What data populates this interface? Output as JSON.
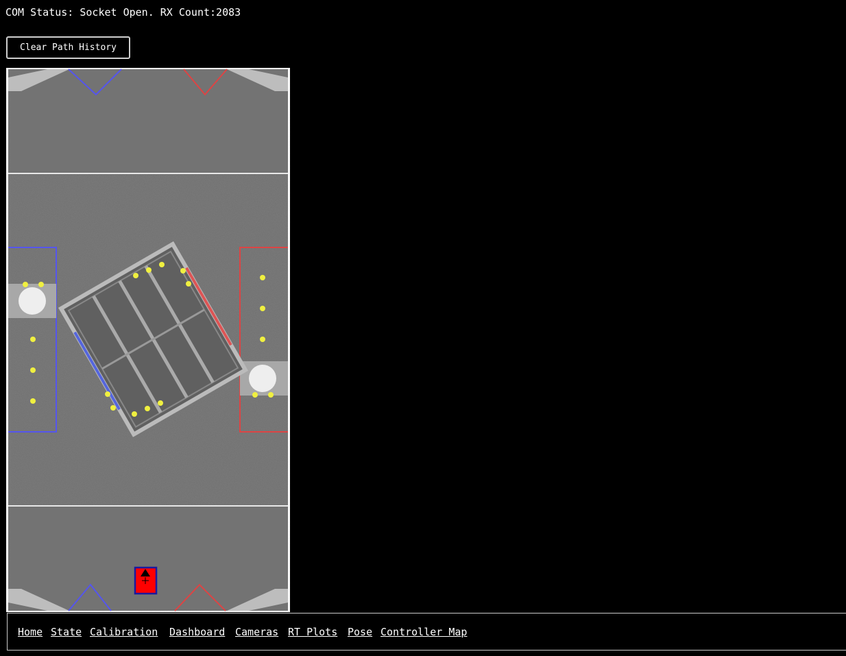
{
  "status": {
    "text": "COM Status: Socket Open. RX Count:2083"
  },
  "toolbar": {
    "clear_label": "Clear Path History"
  },
  "field": {
    "alliance_colors": {
      "blue": "#5555ee",
      "red": "#dd4444"
    },
    "ball_color": "#f0f040",
    "robot_color": "#ff0000"
  },
  "nav": {
    "links": [
      {
        "label": "Home"
      },
      {
        "label": "State"
      },
      {
        "label": "Calibration"
      },
      {
        "label": "Dashboard"
      },
      {
        "label": "Cameras"
      },
      {
        "label": "RT Plots"
      },
      {
        "label": "Pose"
      },
      {
        "label": "Controller Map"
      }
    ]
  }
}
